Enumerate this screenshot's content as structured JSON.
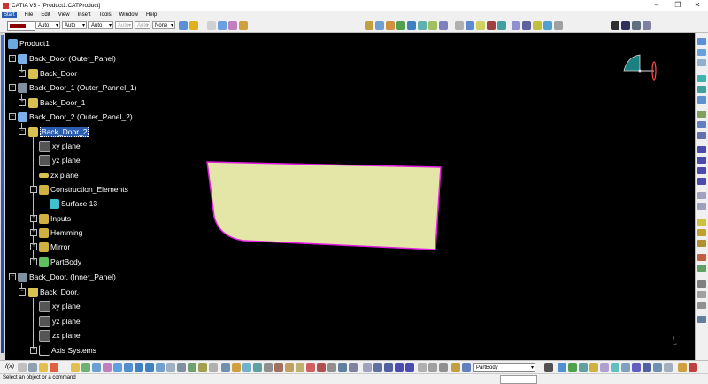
{
  "window": {
    "title": "CATIA V5 - [Product1.CATProduct]",
    "minimize": "–",
    "restore": "❐",
    "close": "✕"
  },
  "menu": [
    "Start",
    "File",
    "Edit",
    "View",
    "Insert",
    "Tools",
    "Window",
    "Help"
  ],
  "toolbar": {
    "color_swatch": "#8b0000",
    "dropdowns": [
      "Auto",
      "Auto",
      "Auto",
      "Auto",
      "Auto",
      "None"
    ]
  },
  "tree": {
    "root": "Product1",
    "nodes": [
      {
        "label": "Back_Door (Outer_Panel)"
      },
      {
        "label": "Back_Door"
      },
      {
        "label": "Back_Door_1 (Outer_Pannel_1)"
      },
      {
        "label": "Back_Door_1"
      },
      {
        "label": "Back_Door_2 (Outer_Panel_2)"
      },
      {
        "label": "Back_Door_2"
      },
      {
        "label": "xy plane"
      },
      {
        "label": "yz plane"
      },
      {
        "label": "zx plane"
      },
      {
        "label": "Construction_Elements"
      },
      {
        "label": "Surface.13"
      },
      {
        "label": "Inputs"
      },
      {
        "label": "Hemming"
      },
      {
        "label": "Mirror"
      },
      {
        "label": "PartBody"
      },
      {
        "label": "Back_Door. (Inner_Panel)"
      },
      {
        "label": "Back_Door."
      },
      {
        "label": "xy plane"
      },
      {
        "label": "yz plane"
      },
      {
        "label": "zx plane"
      },
      {
        "label": "Axis Systems"
      }
    ]
  },
  "viewport": {
    "surface_fill": "#e6e8a8",
    "edge_color": "#e11ee1",
    "compass_color": "#1a8080"
  },
  "bottom_toolbar": {
    "current_body": "PartBody",
    "fx_label": "f(x)"
  },
  "status": {
    "prompt": "Select an object or a command"
  }
}
